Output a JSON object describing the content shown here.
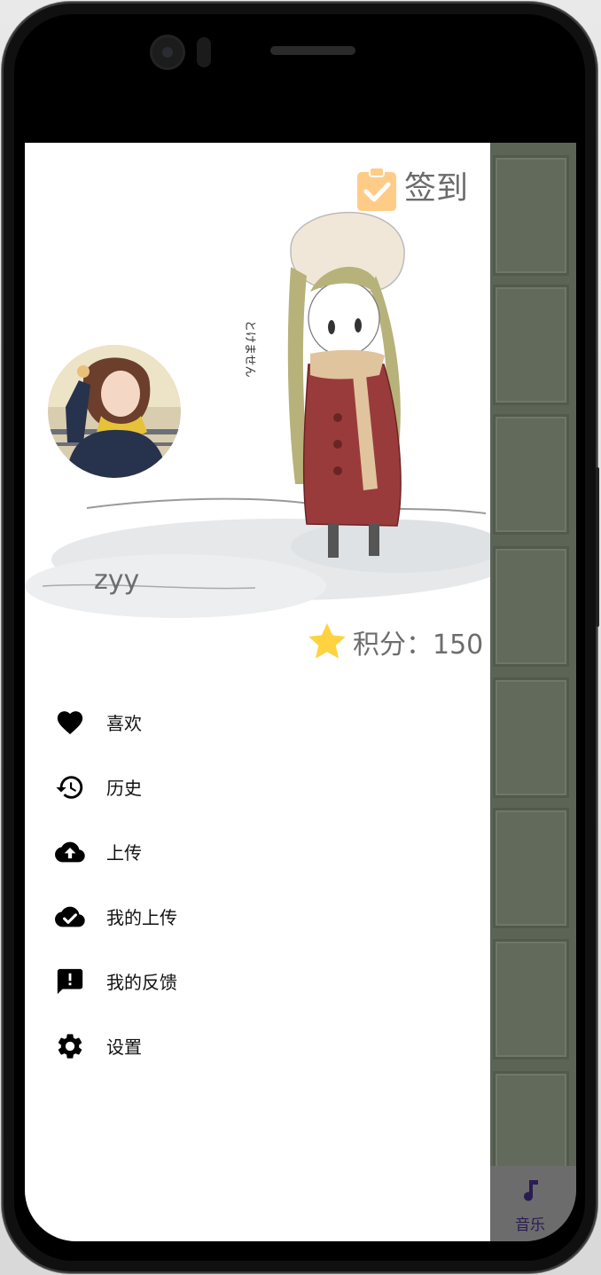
{
  "drawer": {
    "checkin_label": "签到",
    "username": "zyy",
    "points_label": "积分：150",
    "menu": [
      {
        "label": "喜欢",
        "icon": "heart-icon"
      },
      {
        "label": "历史",
        "icon": "history-icon"
      },
      {
        "label": "上传",
        "icon": "cloud-upload-icon"
      },
      {
        "label": "我的上传",
        "icon": "cloud-done-icon"
      },
      {
        "label": "我的反馈",
        "icon": "feedback-icon"
      },
      {
        "label": "设置",
        "icon": "gear-icon"
      }
    ]
  },
  "header_art": {
    "vertical_text": "とけません"
  },
  "bottom_nav": {
    "music_label": "音乐",
    "music_icon": "music-note-icon"
  },
  "colors": {
    "checkin_accent": "#ffcc88",
    "star": "#ffd23f",
    "background_app": "#5c6455",
    "nav_label": "#2a1b55"
  }
}
